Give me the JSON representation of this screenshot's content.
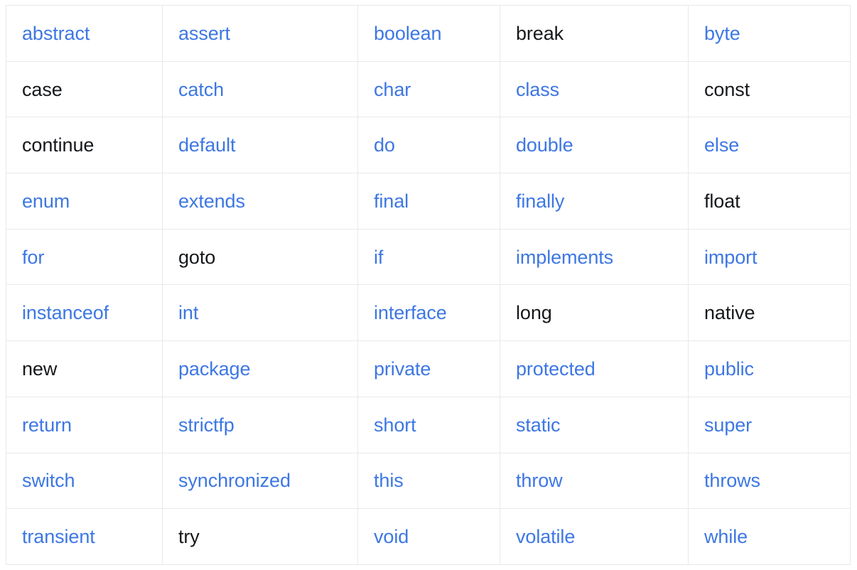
{
  "page": {
    "title": "Java Keywords",
    "background_color": "#ffffff"
  },
  "table": {
    "name": "java-keywords-table",
    "columns": 5,
    "rows": 11,
    "border_color": "#e8e9ea",
    "link_color": "#3d77e3",
    "text_color": "#16181b",
    "cells": [
      [
        {
          "label": "abstract",
          "style": "link"
        },
        {
          "label": "assert",
          "style": "link"
        },
        {
          "label": "boolean",
          "style": "link"
        },
        {
          "label": "break",
          "style": "plain"
        },
        {
          "label": "byte",
          "style": "link"
        }
      ],
      [
        {
          "label": "case",
          "style": "plain"
        },
        {
          "label": "catch",
          "style": "link"
        },
        {
          "label": "char",
          "style": "link"
        },
        {
          "label": "class",
          "style": "link"
        },
        {
          "label": "const",
          "style": "plain"
        }
      ],
      [
        {
          "label": "continue",
          "style": "plain"
        },
        {
          "label": "default",
          "style": "link"
        },
        {
          "label": "do",
          "style": "link"
        },
        {
          "label": "double",
          "style": "link"
        },
        {
          "label": "else",
          "style": "link"
        }
      ],
      [
        {
          "label": "enum",
          "style": "link"
        },
        {
          "label": "extends",
          "style": "link"
        },
        {
          "label": "final",
          "style": "link"
        },
        {
          "label": "finally",
          "style": "link"
        },
        {
          "label": "float",
          "style": "plain"
        }
      ],
      [
        {
          "label": "for",
          "style": "link"
        },
        {
          "label": "goto",
          "style": "plain"
        },
        {
          "label": "if",
          "style": "link"
        },
        {
          "label": "implements",
          "style": "link"
        },
        {
          "label": "import",
          "style": "link"
        }
      ],
      [
        {
          "label": "instanceof",
          "style": "link"
        },
        {
          "label": "int",
          "style": "link"
        },
        {
          "label": "interface",
          "style": "link"
        },
        {
          "label": "long",
          "style": "plain"
        },
        {
          "label": "native",
          "style": "plain"
        }
      ],
      [
        {
          "label": "new",
          "style": "plain"
        },
        {
          "label": "package",
          "style": "link"
        },
        {
          "label": "private",
          "style": "link"
        },
        {
          "label": "protected",
          "style": "link"
        },
        {
          "label": "public",
          "style": "link"
        }
      ],
      [
        {
          "label": "return",
          "style": "link"
        },
        {
          "label": "strictfp",
          "style": "link"
        },
        {
          "label": "short",
          "style": "link"
        },
        {
          "label": "static",
          "style": "link"
        },
        {
          "label": "super",
          "style": "link"
        }
      ],
      [
        {
          "label": "switch",
          "style": "link"
        },
        {
          "label": "synchronized",
          "style": "link"
        },
        {
          "label": "this",
          "style": "link"
        },
        {
          "label": "throw",
          "style": "link"
        },
        {
          "label": "throws",
          "style": "link"
        }
      ],
      [
        {
          "label": "transient",
          "style": "link"
        },
        {
          "label": "try",
          "style": "plain"
        },
        {
          "label": "void",
          "style": "link"
        },
        {
          "label": "volatile",
          "style": "link"
        },
        {
          "label": "while",
          "style": "link"
        }
      ]
    ]
  }
}
